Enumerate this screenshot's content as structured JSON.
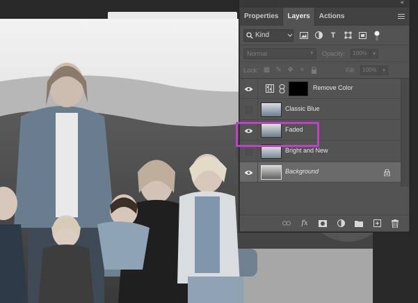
{
  "panel": {
    "collapse_glyph": "«",
    "tabs": [
      {
        "label": "Properties",
        "active": false
      },
      {
        "label": "Layers",
        "active": true
      },
      {
        "label": "Actions",
        "active": false
      }
    ]
  },
  "filter": {
    "kind_label": "Kind",
    "icons": [
      "image-filter-icon",
      "adjustment-filter-icon",
      "type-filter-icon",
      "shape-filter-icon",
      "smart-object-filter-icon",
      "filter-toggle-icon"
    ]
  },
  "blend": {
    "mode": "Normal",
    "opacity_label": "Opacity:",
    "opacity_value": "100%",
    "fill_label": "Fill:",
    "fill_value": "100%"
  },
  "lock": {
    "label": "Lock:",
    "icons": [
      "lock-transparent-pixels-icon",
      "lock-image-pixels-icon",
      "lock-position-icon",
      "lock-artboard-icon",
      "lock-all-icon"
    ]
  },
  "layers": [
    {
      "name": "Remove Color",
      "visible": true,
      "type": "adjustment",
      "selected": false
    },
    {
      "name": "Classic Blue",
      "visible": false,
      "type": "image",
      "selected": false
    },
    {
      "name": "Faded",
      "visible": true,
      "type": "image",
      "selected": false
    },
    {
      "name": "Bright and New",
      "visible": false,
      "type": "image",
      "selected": false
    },
    {
      "name": "Background",
      "visible": true,
      "type": "background",
      "selected": true,
      "locked": true
    }
  ],
  "bottom_icons": [
    "link-layers-icon",
    "fx-icon",
    "mask-icon",
    "adjustment-layer-icon",
    "group-folder-icon",
    "new-layer-icon",
    "trash-icon"
  ],
  "fx_label": "fx",
  "colors": {
    "highlight": "#c040c8",
    "panel_bg": "#535353",
    "selected_row": "#6a6a6a"
  }
}
